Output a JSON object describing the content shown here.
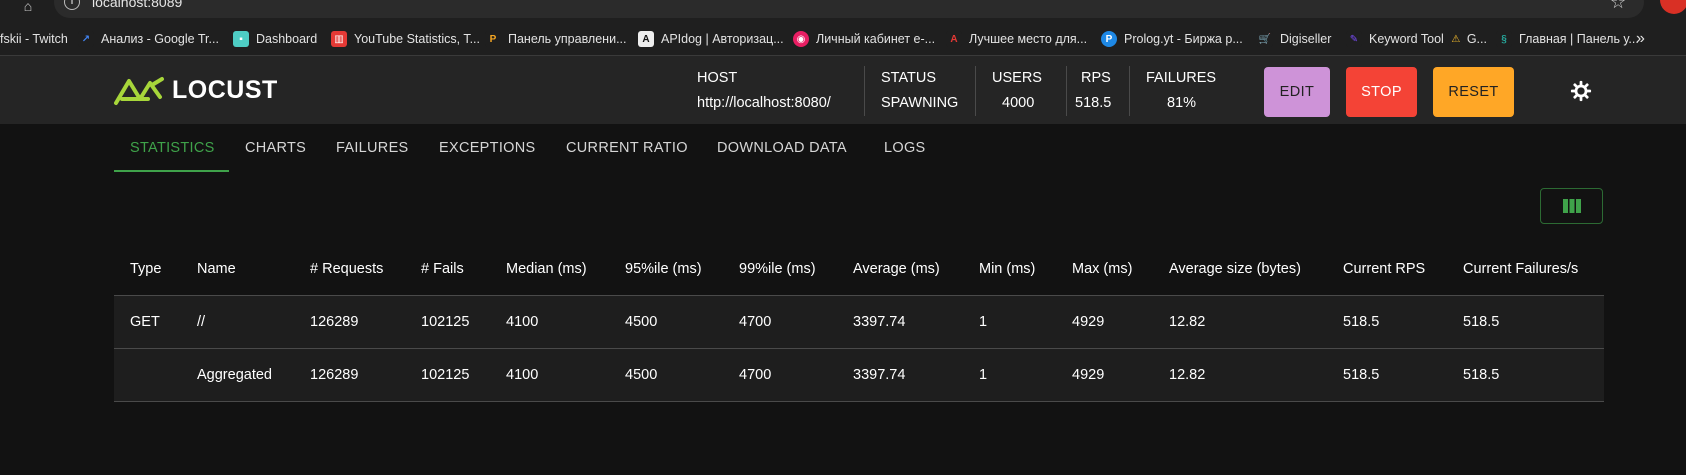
{
  "browser": {
    "address": "localhost:8089",
    "bookmarks": [
      {
        "label": "fskii - Twitch",
        "icon": "twitch-icon",
        "color": "#1f1f1f"
      },
      {
        "label": "Анализ - Google Tr...",
        "icon": "trends-icon",
        "color": "#4285f4"
      },
      {
        "label": "Dashboard",
        "icon": "dashboard-icon",
        "color": "#4ecdc4"
      },
      {
        "label": "YouTube Statistics, T...",
        "icon": "stats-icon",
        "color": "#e53935"
      },
      {
        "label": "Панель управлени...",
        "icon": "panel-icon",
        "color": "#f5a623"
      },
      {
        "label": "APIdog | Авторизац...",
        "icon": "apidog-icon",
        "color": "#111111"
      },
      {
        "label": "Личный кабинет e-...",
        "icon": "cabinet-icon",
        "color": "#e91e63"
      },
      {
        "label": "Лучшее место для...",
        "icon": "adobe-icon",
        "color": "#e53935"
      },
      {
        "label": "Prolog.yt - Биржа р...",
        "icon": "prolog-icon",
        "color": "#1e88e5"
      },
      {
        "label": "Digiseller",
        "icon": "cart-icon",
        "color": "#29b6f6"
      },
      {
        "label": "Keyword Tool",
        "icon": "keyword-icon",
        "color": "#7c4dff"
      },
      {
        "label": "G...",
        "icon": "warning-icon",
        "color": "#fbc02d"
      },
      {
        "label": "Главная | Панель у...",
        "icon": "panel2-icon",
        "color": "#26a69a"
      }
    ],
    "more": "»"
  },
  "header": {
    "logo_text": "LOCUST",
    "host_label": "HOST",
    "host_value": "http://localhost:8080/",
    "status_label": "STATUS",
    "status_value": "SPAWNING",
    "users_label": "USERS",
    "users_value": "4000",
    "rps_label": "RPS",
    "rps_value": "518.5",
    "failures_label": "FAILURES",
    "failures_value": "81%",
    "edit_label": "EDIT",
    "stop_label": "STOP",
    "reset_label": "RESET"
  },
  "tabs": [
    "STATISTICS",
    "CHARTS",
    "FAILURES",
    "EXCEPTIONS",
    "CURRENT RATIO",
    "DOWNLOAD DATA",
    "LOGS"
  ],
  "colors": {
    "accent": "#3fa24a",
    "edit": "#ce93d8",
    "stop": "#f44336",
    "reset": "#ffa726"
  },
  "table": {
    "columns": [
      "Type",
      "Name",
      "# Requests",
      "# Fails",
      "Median (ms)",
      "95%ile (ms)",
      "99%ile (ms)",
      "Average (ms)",
      "Min (ms)",
      "Max (ms)",
      "Average size (bytes)",
      "Current RPS",
      "Current Failures/s"
    ],
    "rows": [
      [
        "GET",
        "//",
        "126289",
        "102125",
        "4100",
        "4500",
        "4700",
        "3397.74",
        "1",
        "4929",
        "12.82",
        "518.5",
        "518.5"
      ],
      [
        "",
        "Aggregated",
        "126289",
        "102125",
        "4100",
        "4500",
        "4700",
        "3397.74",
        "1",
        "4929",
        "12.82",
        "518.5",
        "518.5"
      ]
    ]
  }
}
